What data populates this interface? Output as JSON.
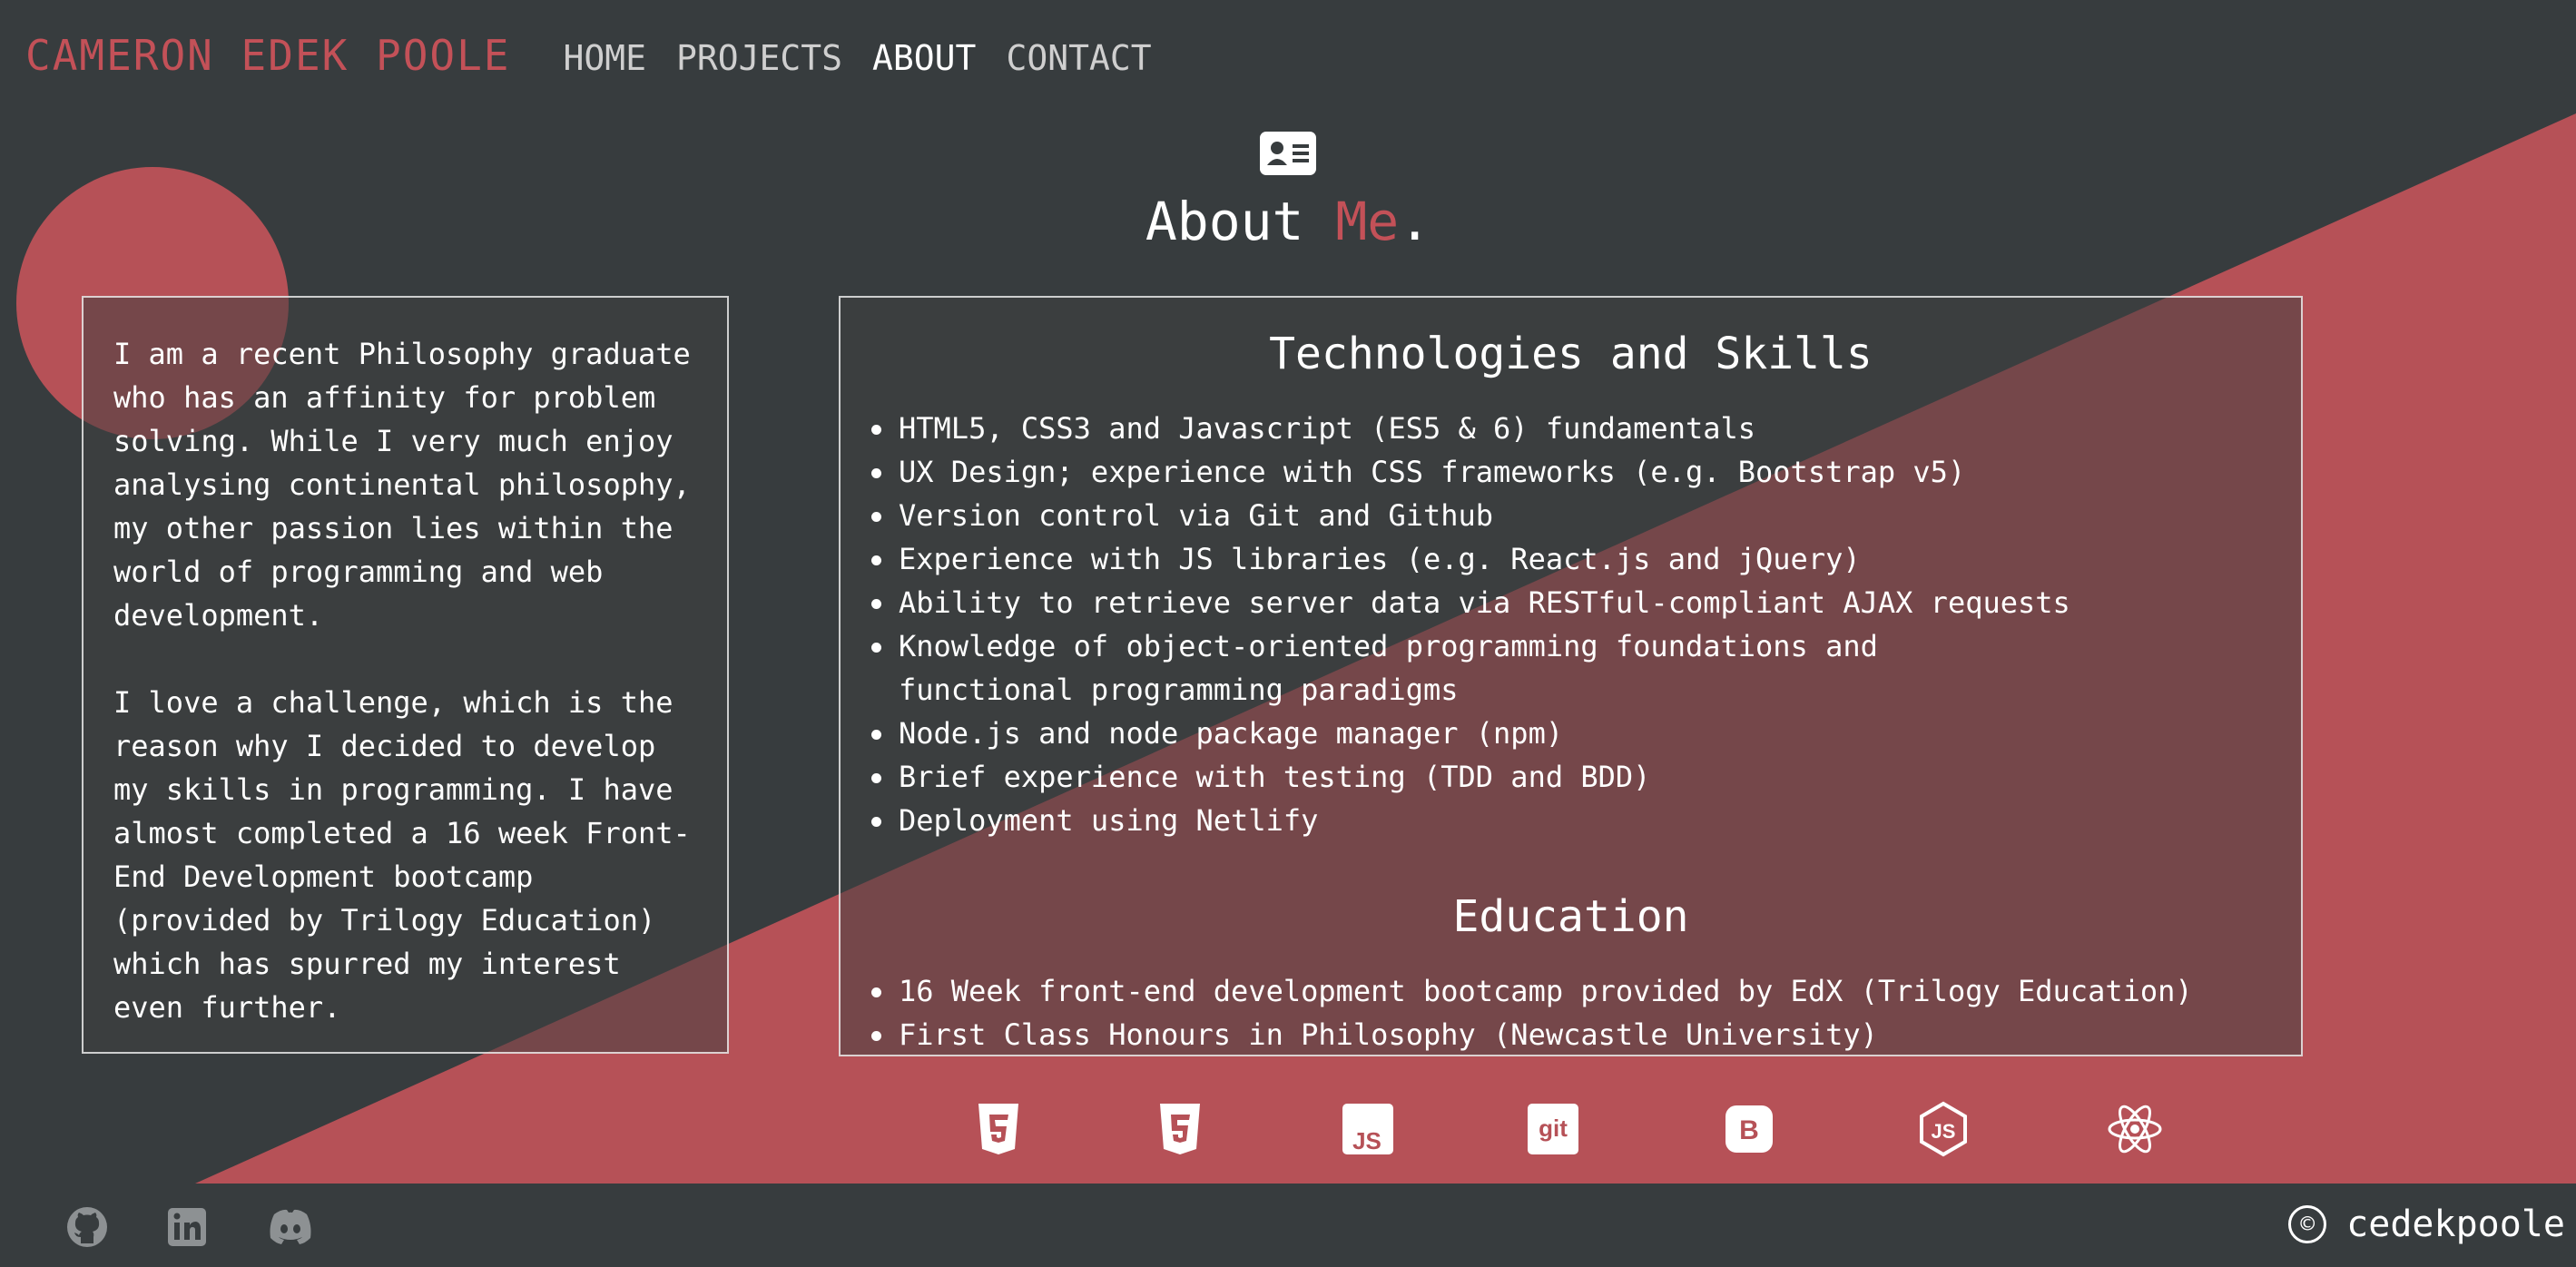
{
  "nav": {
    "brand": "CAMERON EDEK POOLE",
    "links": [
      {
        "label": "HOME"
      },
      {
        "label": "PROJECTS"
      },
      {
        "label": "ABOUT"
      },
      {
        "label": "CONTACT"
      }
    ]
  },
  "header": {
    "icon": "id-card-icon",
    "title_main": "About ",
    "title_accent": "Me",
    "title_end": "."
  },
  "bio": {
    "paragraphs": [
      "I am a recent Philosophy graduate who has an affinity for problem solving. While I very much enjoy analysing continental philosophy, my other passion lies within the world of programming and web development.",
      "I love a challenge, which is the reason why I decided to develop my skills in programming. I have almost completed a 16 week Front-End Development bootcamp (provided by Trilogy Education) which has spurred my interest even further."
    ]
  },
  "skills": {
    "heading": "Technologies and Skills",
    "items": [
      "HTML5, CSS3 and Javascript (ES5 & 6) fundamentals",
      "UX Design; experience with CSS frameworks (e.g. Bootstrap v5)",
      "Version control via Git and Github",
      "Experience with JS libraries (e.g. React.js and jQuery)",
      "Ability to retrieve server data via RESTful-compliant AJAX requests",
      "Knowledge of object-oriented programming foundations and functional programming paradigms",
      "Node.js and node package manager (npm)",
      "Brief experience with testing (TDD and BDD)",
      "Deployment using Netlify"
    ]
  },
  "education": {
    "heading": "Education",
    "items": [
      "16 Week front-end development bootcamp provided by EdX (Trilogy Education)",
      "First Class Honours in Philosophy (Newcastle University)"
    ]
  },
  "tech_icons": [
    "html5-icon",
    "css3-icon",
    "javascript-icon",
    "git-icon",
    "bootstrap-icon",
    "nodejs-icon",
    "react-icon"
  ],
  "tech_icon_text": {
    "js": "JS",
    "git": "git",
    "bootstrap": "B"
  },
  "footer": {
    "social_icons": [
      "github-icon",
      "linkedin-icon",
      "discord-icon"
    ],
    "copyright_symbol": "©",
    "copyright": "cedekpoole"
  },
  "colors": {
    "background": "#373c3e",
    "accent": "#c35158",
    "triangle": "#b65157"
  }
}
